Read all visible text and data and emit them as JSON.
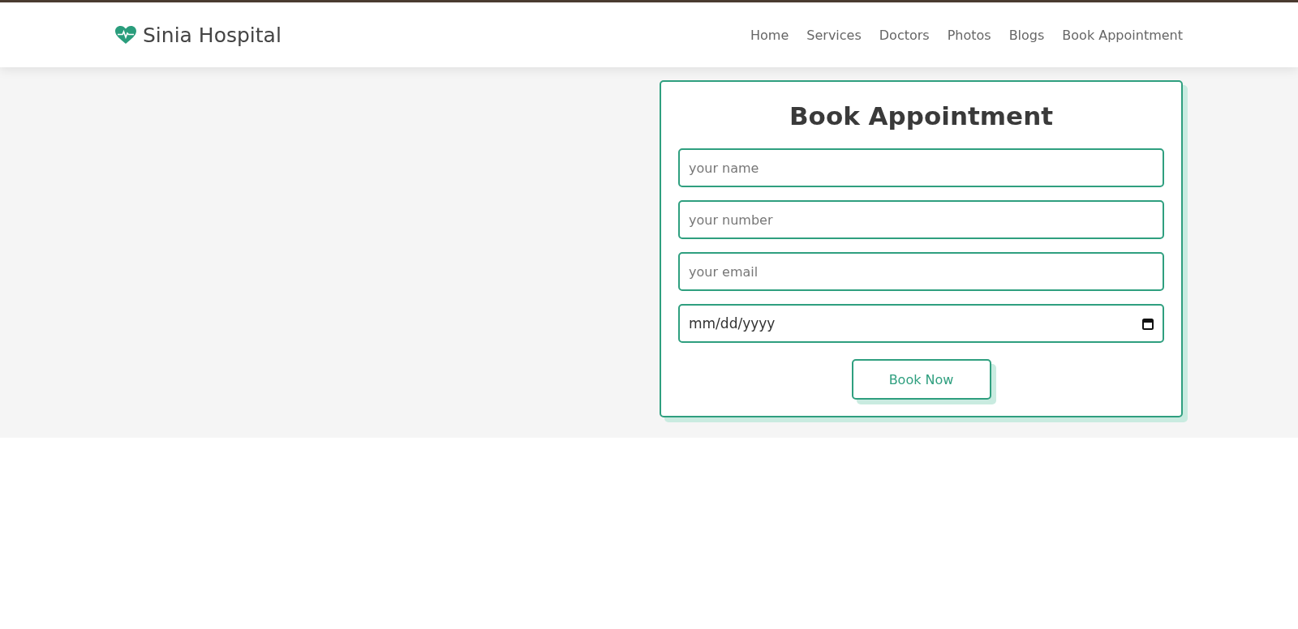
{
  "header": {
    "logo": "Sinia Hospital",
    "nav": [
      {
        "label": "Home"
      },
      {
        "label": "Services"
      },
      {
        "label": "Doctors"
      },
      {
        "label": "Photos"
      },
      {
        "label": "Blogs"
      },
      {
        "label": "Book Appointment"
      }
    ]
  },
  "form": {
    "title": "Book Appointment",
    "fields": [
      {
        "kind": "text",
        "placeholder": "your name"
      },
      {
        "kind": "text",
        "placeholder": "your number"
      },
      {
        "kind": "text",
        "placeholder": "your email"
      },
      {
        "kind": "date",
        "placeholder": "mm/dd/yyyy"
      }
    ],
    "button": "Book Now"
  }
}
